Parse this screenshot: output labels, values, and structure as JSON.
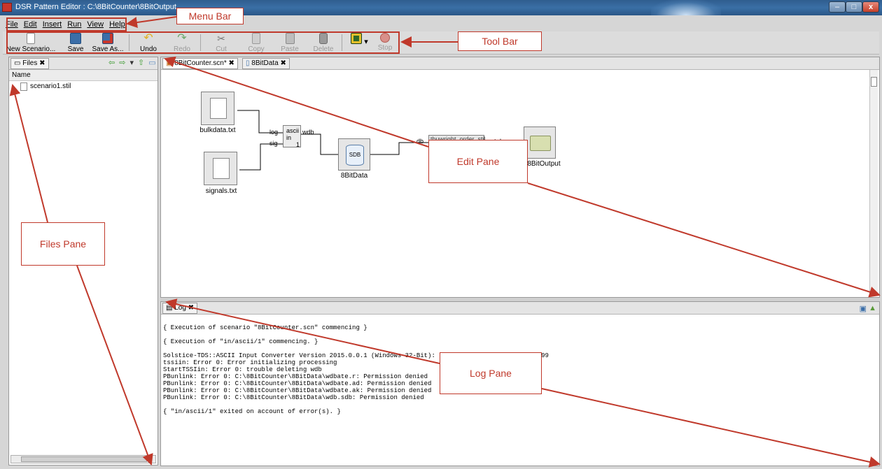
{
  "window": {
    "title": "DSR Pattern Editor : C:\\8BitCounter\\8BitOutput",
    "controls": {
      "minimize": "–",
      "maximize": "□",
      "close": "x"
    }
  },
  "menubar": {
    "items": [
      "File",
      "Edit",
      "Insert",
      "Run",
      "View",
      "Help"
    ]
  },
  "toolbar": {
    "new_label": "New Scenario...",
    "save_label": "Save",
    "saveas_label": "Save As...",
    "undo_label": "Undo",
    "redo_label": "Redo",
    "cut_label": "Cut",
    "copy_label": "Copy",
    "paste_label": "Paste",
    "delete_label": "Delete",
    "stop_label": "Stop"
  },
  "files_pane": {
    "tab_label": "Files",
    "column_header": "Name",
    "items": [
      "scenario1.stil"
    ]
  },
  "editor": {
    "tabs": [
      "8BitCounter.scn*",
      "8BitData"
    ],
    "blocks": {
      "bulkdata": "bulkdata.txt",
      "signals": "signals.txt",
      "ascii_top": "ascii",
      "ascii_mid": "in",
      "ascii_num": "1",
      "sdb": "SDB",
      "data_label": "8BitData",
      "stil_label": "tbuwright_order_stil",
      "output_label": "8BitOutput"
    },
    "ports": {
      "log": "log",
      "sig": "sig",
      "wdb": "wdb",
      "db": "db",
      "out": "out dr"
    }
  },
  "log_pane": {
    "tab_label": "Log",
    "lines": [
      "{ Execution of scenario \"8BitCounter.scn\" commencing }",
      "",
      "{ Execution of \"in/ascii/1\" commencing. }",
      "",
      "Solstice-TDS::ASCII Input Converter Version 2015.0.0.1 (Windows 32-Bit): License expires on 12/31/9999",
      "tssiin: Error 0: Error initializing processing",
      "StartTSSIin: Error 0: trouble deleting wdb",
      "PBunlink: Error 0: C:\\8BitCounter\\8BitData\\wdbate.r: Permission denied",
      "PBunlink: Error 0: C:\\8BitCounter\\8BitData\\wdbate.ad: Permission denied",
      "PBunlink: Error 0: C:\\8BitCounter\\8BitData\\wdbate.ak: Permission denied",
      "PBunlink: Error 0: C:\\8BitCounter\\8BitData\\wdb.sdb: Permission denied",
      "",
      "{ \"in/ascii/1\" exited on account of error(s). }"
    ]
  },
  "annotations": {
    "menu_bar": "Menu Bar",
    "tool_bar": "Tool Bar",
    "edit_pane": "Edit Pane",
    "files_pane": "Files Pane",
    "log_pane": "Log Pane"
  },
  "colors": {
    "annotation": "#c0392b",
    "titlebar": "#3a6fa5"
  }
}
